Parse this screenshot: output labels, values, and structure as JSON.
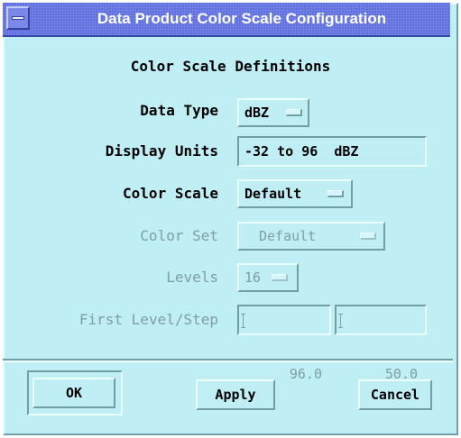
{
  "window": {
    "title": "Data Product Color Scale Configuration"
  },
  "section_title": "Color Scale Definitions",
  "rows": {
    "data_type": {
      "label": "Data Type",
      "value": "dBZ"
    },
    "display_units": {
      "label": "Display Units",
      "value": "-32 to 96  dBZ"
    },
    "color_scale": {
      "label": "Color Scale",
      "value": "Default"
    },
    "color_set": {
      "label": "Color Set",
      "value": "Default"
    },
    "levels": {
      "label": "Levels",
      "value": "16"
    },
    "first_level_step": {
      "label": "First Level/Step",
      "first_level": "96.0",
      "step": "50.0"
    }
  },
  "buttons": {
    "ok": "OK",
    "apply": "Apply",
    "cancel": "Cancel"
  },
  "colors": {
    "background": "#bfeff4",
    "titlebar": "#5f6fe0",
    "disabled_text": "#7e9ea2"
  }
}
